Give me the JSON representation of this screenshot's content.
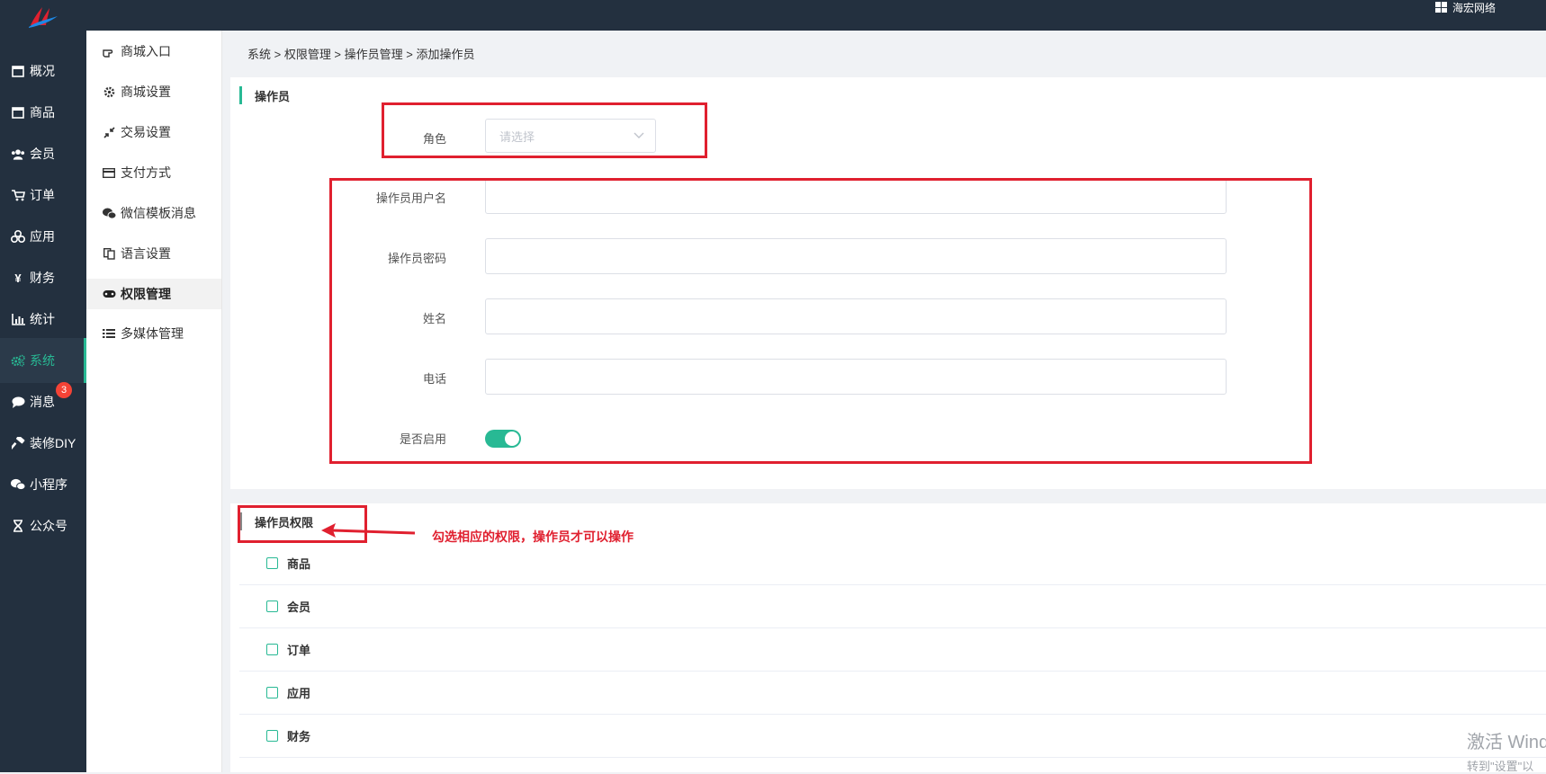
{
  "header": {
    "brand_name": "海宏网络"
  },
  "left_nav": {
    "items": [
      {
        "label": "概况",
        "icon": "dashboard-icon"
      },
      {
        "label": "商品",
        "icon": "goods-icon"
      },
      {
        "label": "会员",
        "icon": "users-icon"
      },
      {
        "label": "订单",
        "icon": "cart-icon"
      },
      {
        "label": "应用",
        "icon": "apps-icon"
      },
      {
        "label": "财务",
        "icon": "yen-icon"
      },
      {
        "label": "统计",
        "icon": "bar-chart-icon"
      },
      {
        "label": "系统",
        "icon": "gears-icon",
        "active": true
      },
      {
        "label": "消息",
        "icon": "chat-icon",
        "badge": "3"
      },
      {
        "label": "装修DIY",
        "icon": "hammer-icon"
      },
      {
        "label": "小程序",
        "icon": "wechat-icon"
      },
      {
        "label": "公众号",
        "icon": "hourglass-icon"
      }
    ],
    "accent_color": "#28b994"
  },
  "sub_nav": {
    "items": [
      {
        "label": "商城入口",
        "icon": "hand-pointer-icon"
      },
      {
        "label": "商城设置",
        "icon": "gear-icon"
      },
      {
        "label": "交易设置",
        "icon": "compress-icon"
      },
      {
        "label": "支付方式",
        "icon": "credit-card-icon"
      },
      {
        "label": "微信模板消息",
        "icon": "wechat-icon"
      },
      {
        "label": "语言设置",
        "icon": "language-icon"
      },
      {
        "label": "权限管理",
        "icon": "gamepad-icon",
        "active": true
      },
      {
        "label": "多媒体管理",
        "icon": "list-icon"
      }
    ]
  },
  "breadcrumb": "系统 > 权限管理 > 操作员管理 > 添加操作员",
  "operator_section": {
    "title": "操作员",
    "role_label": "角色",
    "role_placeholder": "请选择",
    "username_label": "操作员用户名",
    "username_value": "",
    "password_label": "操作员密码",
    "password_value": "",
    "name_label": "姓名",
    "name_value": "",
    "phone_label": "电话",
    "phone_value": "",
    "enabled_label": "是否启用",
    "enabled": true
  },
  "permission_section": {
    "title": "操作员权限",
    "annotation": "勾选相应的权限，操作员才可以操作",
    "items": [
      "商品",
      "会员",
      "订单",
      "应用",
      "财务"
    ]
  },
  "watermark": {
    "line1": "激活 Windo",
    "line2": "转到\"设置\"以"
  },
  "colors": {
    "sidebar_bg": "#23303f",
    "accent": "#28b994",
    "annotation_red": "#e0202f",
    "badge_red": "#f44336"
  }
}
